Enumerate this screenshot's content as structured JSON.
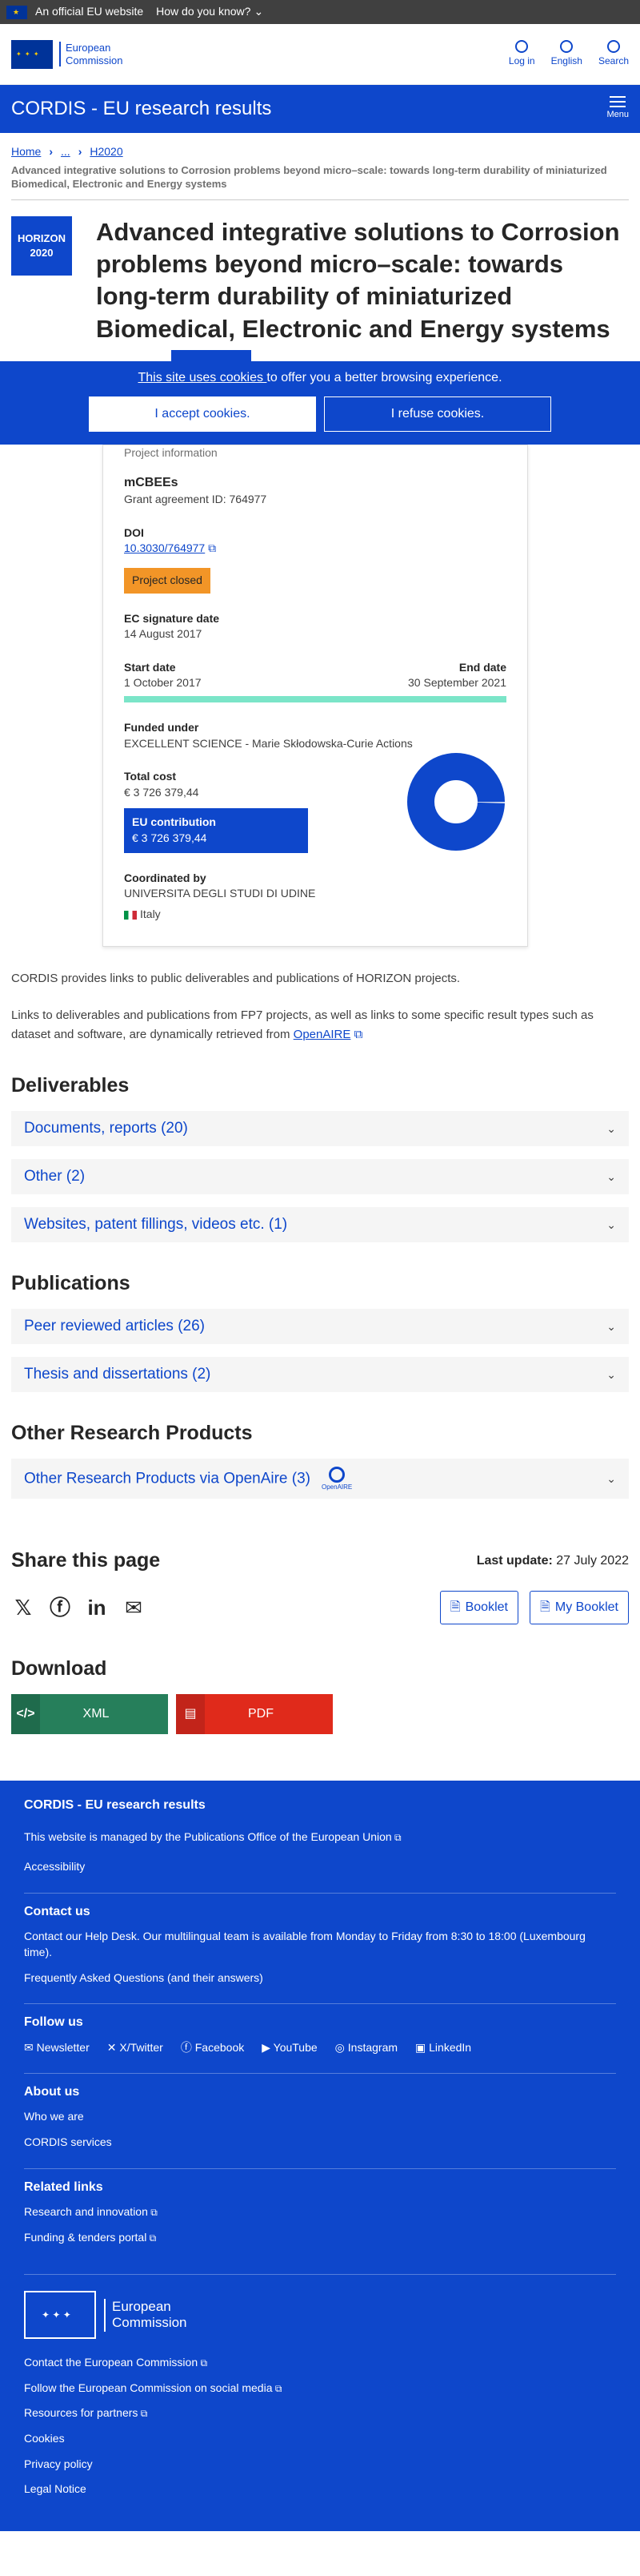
{
  "topbar": {
    "official": "An official EU website",
    "know": "How do you know?"
  },
  "header": {
    "logo_line1": "European",
    "logo_line2": "Commission",
    "login": "Log in",
    "lang": "English",
    "search": "Search"
  },
  "site": {
    "title": "CORDIS - EU research results",
    "menu": "Menu"
  },
  "breadcrumb": {
    "home": "Home",
    "dots": "...",
    "h2020": "H2020"
  },
  "subhead": "Advanced integrative solutions to Corrosion problems beyond micro–scale: towards long-term durability of miniaturized Biomedical, Electronic and Energy systems",
  "badge": {
    "line1": "HORIZON",
    "line2": "2020"
  },
  "title": "Advanced integrative solutions to Corrosion problems beyond micro–scale: towards long-term durability of miniaturized Biomedical, Electronic and Energy systems",
  "cookie": {
    "link": "This site uses cookies ",
    "text": "to offer you a better browsing experience.",
    "accept": "I accept cookies.",
    "refuse": "I refuse cookies."
  },
  "project": {
    "section": "Project information",
    "acronym": "mCBEEs",
    "grant_label": "Grant agreement ID: 764977",
    "doi_label": "DOI",
    "doi": "10.3030/764977",
    "status": "Project closed",
    "ec_sig_label": "EC signature date",
    "ec_sig": "14 August 2017",
    "start_label": "Start date",
    "start": "1 October 2017",
    "end_label": "End date",
    "end": "30 September 2021",
    "progress": 1.0,
    "funded_label": "Funded under",
    "funded": "EXCELLENT SCIENCE - Marie Skłodowska-Curie Actions",
    "cost_label": "Total cost",
    "cost": "€ 3 726 379,44",
    "eu_label": "EU contribution",
    "eu": "€ 3 726 379,44",
    "eu_share": 1.0,
    "coord_label": "Coordinated by",
    "coord": "UNIVERSITA DEGLI STUDI DI UDINE",
    "country": "Italy"
  },
  "info1": "CORDIS provides links to public deliverables and publications of HORIZON projects.",
  "info2": "Links to deliverables and publications from FP7 projects, as well as links to some specific result types such as dataset and software, are dynamically retrieved from ",
  "openaire_link": "OpenAIRE",
  "deliverables": {
    "heading": "Deliverables",
    "items": [
      "Documents, reports (20)",
      "Other (2)",
      "Websites, patent fillings, videos etc. (1)"
    ]
  },
  "publications": {
    "heading": "Publications",
    "items": [
      "Peer reviewed articles (26)",
      "Thesis and dissertations (2)"
    ]
  },
  "other": {
    "heading": "Other Research Products",
    "item": "Other Research Products via OpenAire (3)",
    "logo_text": "OpenAIRE"
  },
  "share": {
    "heading": "Share this page",
    "last_update_label": "Last update:",
    "last_update": " 27 July 2022",
    "booklet": "Booklet",
    "mybooklet": "My Booklet"
  },
  "download": {
    "heading": "Download",
    "xml": "XML",
    "pdf": "PDF"
  },
  "footer": {
    "title": "CORDIS - EU research results",
    "managed": "This website is managed by the ",
    "managed_link": "Publications Office of the European Union",
    "accessibility": "Accessibility",
    "contact_heading": "Contact us",
    "helpdesk": "Contact our Help Desk",
    "helpdesk_rest": ". Our multilingual team is available from Monday to Friday from 8:30 to 18:00 (Luxembourg time).",
    "faq": "Frequently Asked Questions",
    "faq_rest": " (and their answers)",
    "follow_heading": "Follow us",
    "social": [
      "Newsletter",
      "X/Twitter",
      "Facebook",
      "YouTube",
      "Instagram",
      "LinkedIn"
    ],
    "about_heading": "About us",
    "who": "Who we are",
    "services": "CORDIS services",
    "related_heading": "Related links",
    "research": "Research and innovation",
    "funding": "Funding & tenders portal",
    "ec_line1": "European",
    "ec_line2": "Commission",
    "bottom": [
      "Contact the European Commission",
      "Follow the European Commission on social media",
      "Resources for partners",
      "Cookies",
      "Privacy policy",
      "Legal Notice"
    ]
  },
  "colors": {
    "primary": "#0e47cb",
    "cookie_bg": "#0e47cb",
    "status": "#f29527",
    "progress": "#7be5c8",
    "xml": "#267f5b",
    "pdf": "#e02a1b"
  }
}
